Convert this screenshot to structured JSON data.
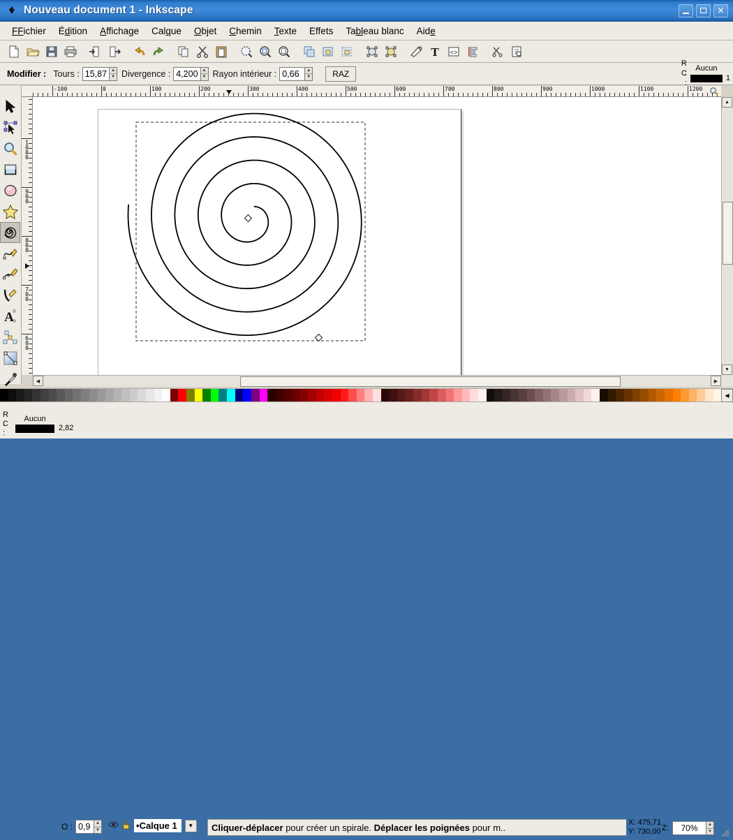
{
  "window": {
    "title": "Nouveau document 1 - Inkscape",
    "icon": "inkscape-diamond-icon",
    "minimize_label": "",
    "maximize_label": "",
    "close_label": "×"
  },
  "menubar": {
    "items": [
      {
        "label": "Fichier",
        "mnemonic": "F"
      },
      {
        "label": "Édition",
        "mnemonic": "d"
      },
      {
        "label": "Affichage",
        "mnemonic": "A"
      },
      {
        "label": "Calque",
        "mnemonic": "q"
      },
      {
        "label": "Objet",
        "mnemonic": "O"
      },
      {
        "label": "Chemin",
        "mnemonic": "C"
      },
      {
        "label": "Texte",
        "mnemonic": "T"
      },
      {
        "label": "Effets",
        "mnemonic": ""
      },
      {
        "label": "Tableau blanc",
        "mnemonic": "bl"
      },
      {
        "label": "Aide",
        "mnemonic": "e"
      }
    ]
  },
  "commandbar": {
    "buttons": [
      {
        "name": "new-document-icon"
      },
      {
        "name": "open-document-icon"
      },
      {
        "name": "save-document-icon"
      },
      {
        "name": "print-document-icon"
      },
      {
        "name": "import-icon"
      },
      {
        "name": "export-icon"
      },
      {
        "name": "undo-icon"
      },
      {
        "name": "redo-icon"
      },
      {
        "name": "copy-icon"
      },
      {
        "name": "cut-icon"
      },
      {
        "name": "paste-icon"
      },
      {
        "name": "zoom-selection-icon"
      },
      {
        "name": "zoom-drawing-icon"
      },
      {
        "name": "zoom-page-icon"
      },
      {
        "name": "duplicate-icon"
      },
      {
        "name": "group-icon"
      },
      {
        "name": "ungroup-icon"
      },
      {
        "name": "object-properties-icon"
      },
      {
        "name": "fill-stroke-icon"
      },
      {
        "name": "xml-editor-icon"
      },
      {
        "name": "text-tool-icon"
      },
      {
        "name": "xml-node-icon"
      },
      {
        "name": "align-icon"
      },
      {
        "name": "preferences-icon"
      },
      {
        "name": "document-properties-icon"
      }
    ]
  },
  "tooloptions": {
    "modifier_label": "Modifier :",
    "fields": [
      {
        "label": "Tours :",
        "value": "15,87",
        "name": "tours-spinner"
      },
      {
        "label": "Divergence :",
        "value": "4,200",
        "name": "divergence-spinner"
      },
      {
        "label": "Rayon intérieur :",
        "value": "0,66",
        "name": "rayon-interieur-spinner"
      }
    ],
    "reset_label": "RAZ",
    "style": {
      "fill_label": "R :",
      "fill_value": "Aucun",
      "stroke_label": "C :",
      "stroke_color": "#000000",
      "stroke_width": "1"
    }
  },
  "toolbox": {
    "items": [
      {
        "name": "selector-tool",
        "icon": "arrow-pointer-icon",
        "active": false
      },
      {
        "name": "node-tool",
        "icon": "node-editor-icon",
        "active": false
      },
      {
        "name": "zoom-tool",
        "icon": "magnifier-icon",
        "active": false
      },
      {
        "name": "rectangle-tool",
        "icon": "rectangle-icon",
        "active": false
      },
      {
        "name": "ellipse-tool",
        "icon": "ellipse-icon",
        "active": false
      },
      {
        "name": "star-tool",
        "icon": "star-icon",
        "active": false
      },
      {
        "name": "spiral-tool",
        "icon": "spiral-icon",
        "active": true
      },
      {
        "name": "freehand-tool",
        "icon": "pencil-freehand-icon",
        "active": false
      },
      {
        "name": "bezier-tool",
        "icon": "bezier-pen-icon",
        "active": false
      },
      {
        "name": "calligraphy-tool",
        "icon": "calligraphy-pen-icon",
        "active": false
      },
      {
        "name": "text-tool",
        "icon": "letter-a-icon",
        "active": false
      },
      {
        "name": "connector-tool",
        "icon": "connector-icon",
        "active": false
      },
      {
        "name": "gradient-tool",
        "icon": "gradient-icon",
        "active": false
      },
      {
        "name": "dropper-tool",
        "icon": "eyedropper-icon",
        "active": false
      }
    ]
  },
  "rulers": {
    "horizontal_labels": [
      "-100",
      "0",
      "100",
      "200",
      "300",
      "400",
      "500",
      "600",
      "700",
      "800",
      "900",
      "1000",
      "1100",
      "1200"
    ],
    "vertical_labels": [
      "1000",
      "900",
      "800",
      "700",
      "600"
    ],
    "unit_icon": "magnifier-unit-icon"
  },
  "canvas": {
    "object": "spiral",
    "turns": "15,87",
    "divergence": "4,200",
    "inner_radius": "0,66",
    "handles": [
      "inner-handle",
      "outer-handle"
    ],
    "selection_marquee": "dashed"
  },
  "palette": {
    "colors": [
      "#000000",
      "#0d0d0d",
      "#1a1a1a",
      "#262626",
      "#333333",
      "#404040",
      "#4d4d4d",
      "#595959",
      "#666666",
      "#737373",
      "#808080",
      "#8c8c8c",
      "#999999",
      "#a6a6a6",
      "#b3b3b3",
      "#bfbfbf",
      "#cccccc",
      "#d9d9d9",
      "#e6e6e6",
      "#f2f2f2",
      "#ffffff",
      "#800000",
      "#ff0000",
      "#808000",
      "#ffff00",
      "#008000",
      "#00ff00",
      "#008080",
      "#00ffff",
      "#000080",
      "#0000ff",
      "#800080",
      "#ff00ff",
      "#2b0000",
      "#3d0000",
      "#540000",
      "#6b0000",
      "#870000",
      "#a30000",
      "#bf0000",
      "#db0000",
      "#f20000",
      "#ff1a1a",
      "#ff4d4d",
      "#ff8080",
      "#ffb3b3",
      "#ffe0e0",
      "#2b0808",
      "#3d1010",
      "#541818",
      "#6b2020",
      "#872b2b",
      "#a33636",
      "#bf4545",
      "#db5c5c",
      "#f27575",
      "#ff9999",
      "#ffbbbb",
      "#ffdddd",
      "#fff0f0",
      "#120d0d",
      "#241a1a",
      "#362626",
      "#483333",
      "#5a4040",
      "#6d4d4d",
      "#806060",
      "#937373",
      "#a68686",
      "#b99999",
      "#ccacac",
      "#dfc2c2",
      "#f2d9d9",
      "#fff0f0",
      "#1a0d00",
      "#331a00",
      "#4d2600",
      "#663300",
      "#804000",
      "#994d00",
      "#b35900",
      "#cc6600",
      "#e67300",
      "#ff8000",
      "#ff9933",
      "#ffb366",
      "#ffcc99",
      "#ffe6cc",
      "#fff5e6"
    ],
    "scroll_arrow": "◀"
  },
  "statusbar": {
    "style": {
      "fill_label": "R :",
      "fill_value": "Aucun",
      "stroke_label": "C :",
      "stroke_color": "#000000",
      "stroke_width": "2,82"
    },
    "opacity_label": "O :",
    "opacity_value": "0,9",
    "eye_icon": "eye-icon",
    "lock_icon": "unlock-icon",
    "layer_bullet": "•",
    "layer_name": "Calque 1",
    "message_parts": [
      {
        "text": "Cliquer-déplacer",
        "bold": true
      },
      {
        "text": " pour créer un spirale. ",
        "bold": false
      },
      {
        "text": "Déplacer les poignées",
        "bold": true
      },
      {
        "text": " pour m..",
        "bold": false
      }
    ],
    "coord_x": "X: 475,71",
    "coord_y": "Y: 730,00",
    "zoom_label": "Z:",
    "zoom_value": "70%"
  },
  "colors": {
    "titlebar_start": "#1c5fae",
    "titlebar_end": "#1f63b0",
    "chrome": "#eeebe4",
    "canvas_bg": "#ffffff",
    "accent": "#3e8ade"
  }
}
